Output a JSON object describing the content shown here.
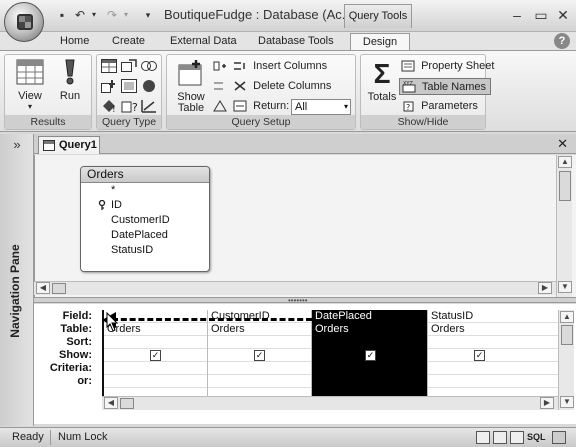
{
  "window": {
    "title": "BoutiqueFudge : Database (Ac...",
    "contextual_tab": "Query Tools",
    "controls": {
      "minimize": "–",
      "restore": "▭",
      "close": "✕"
    }
  },
  "ribbon_tabs": [
    {
      "label": "Home",
      "active": false
    },
    {
      "label": "Create",
      "active": false
    },
    {
      "label": "External Data",
      "active": false
    },
    {
      "label": "Database Tools",
      "active": false
    },
    {
      "label": "Design",
      "active": true
    }
  ],
  "ribbon": {
    "results": {
      "label": "Results",
      "view": "View",
      "run": "Run"
    },
    "query_type": {
      "label": "Query Type"
    },
    "query_setup": {
      "label": "Query Setup",
      "show_table": "Show\nTable",
      "insert_columns": "Insert Columns",
      "delete_columns": "Delete Columns",
      "return_label": "Return:",
      "return_value": "All"
    },
    "show_hide": {
      "label": "Show/Hide",
      "totals": "Totals",
      "property_sheet": "Property Sheet",
      "table_names": "Table Names",
      "parameters": "Parameters"
    }
  },
  "nav_pane": {
    "toggle": "»",
    "label": "Navigation Pane"
  },
  "document": {
    "tab_label": "Query1",
    "close": "✕"
  },
  "table": {
    "name": "Orders",
    "fields": [
      "*",
      "ID",
      "CustomerID",
      "DatePlaced",
      "StatusID"
    ]
  },
  "grid": {
    "row_labels": [
      "Field:",
      "Table:",
      "Sort:",
      "Show:",
      "Criteria:",
      "or:"
    ],
    "columns": [
      {
        "field": "",
        "table": "Orders",
        "show": true
      },
      {
        "field": "CustomerID",
        "table": "Orders",
        "show": true
      },
      {
        "field": "DatePlaced",
        "table": "Orders",
        "show": true,
        "selected": true
      },
      {
        "field": "StatusID",
        "table": "Orders",
        "show": true
      }
    ]
  },
  "statusbar": {
    "mode": "Ready",
    "numlock": "Num Lock",
    "sql": "SQL"
  }
}
